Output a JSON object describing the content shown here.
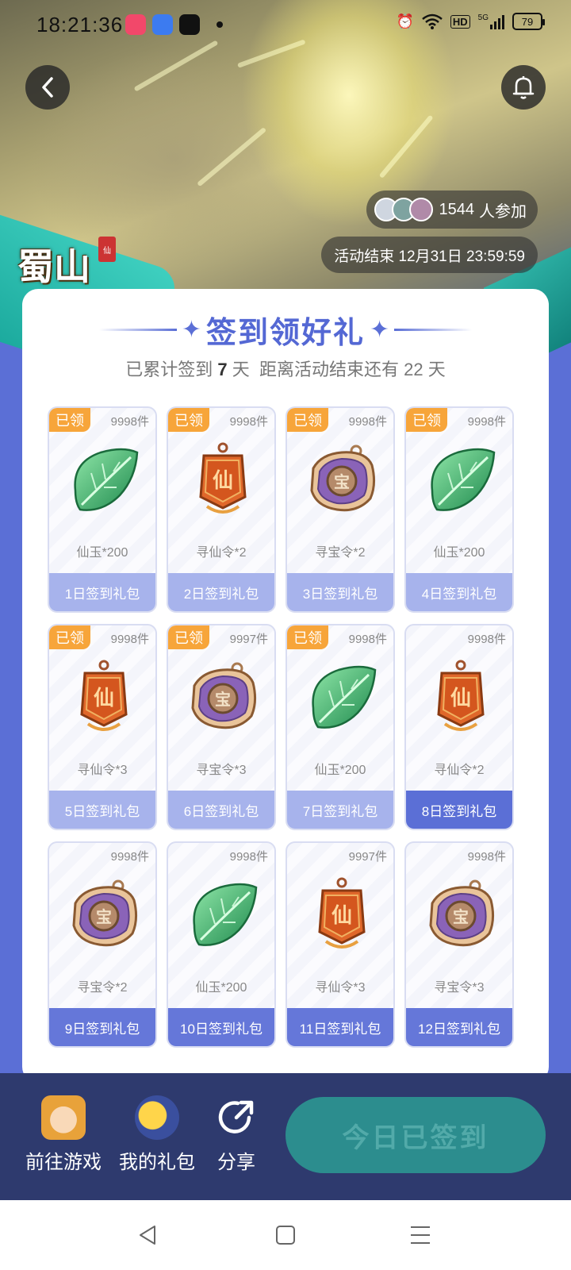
{
  "status_bar": {
    "time": "18:21:36",
    "network": "5G",
    "hd": "HD",
    "battery": "79"
  },
  "header": {
    "participants_count": "1544",
    "participants_suffix": "人参加",
    "end_time": "活动结束 12月31日 23:59:59",
    "game_logo_text": "蜀山"
  },
  "card": {
    "title": "签到领好礼",
    "subtitle_prefix": "已累计签到",
    "signed_days": "7",
    "subtitle_mid": "天  距离活动结束还有",
    "remaining_days": "22",
    "subtitle_suffix": "天"
  },
  "claimed_label": "已领",
  "rewards": [
    {
      "day_label": "1日签到礼包",
      "item": "仙玉*200",
      "stock": "9998件",
      "claimed": true,
      "icon": "jade-leaf-icon"
    },
    {
      "day_label": "2日签到礼包",
      "item": "寻仙令*2",
      "stock": "9998件",
      "claimed": true,
      "icon": "xian-token-icon"
    },
    {
      "day_label": "3日签到礼包",
      "item": "寻宝令*2",
      "stock": "9998件",
      "claimed": true,
      "icon": "treasure-token-icon"
    },
    {
      "day_label": "4日签到礼包",
      "item": "仙玉*200",
      "stock": "9998件",
      "claimed": true,
      "icon": "jade-leaf-icon"
    },
    {
      "day_label": "5日签到礼包",
      "item": "寻仙令*3",
      "stock": "9998件",
      "claimed": true,
      "icon": "xian-token-icon"
    },
    {
      "day_label": "6日签到礼包",
      "item": "寻宝令*3",
      "stock": "9997件",
      "claimed": true,
      "icon": "treasure-token-icon"
    },
    {
      "day_label": "7日签到礼包",
      "item": "仙玉*200",
      "stock": "9998件",
      "claimed": true,
      "icon": "jade-leaf-icon"
    },
    {
      "day_label": "8日签到礼包",
      "item": "寻仙令*2",
      "stock": "9998件",
      "claimed": false,
      "icon": "xian-token-icon"
    },
    {
      "day_label": "9日签到礼包",
      "item": "寻宝令*2",
      "stock": "9998件",
      "claimed": false,
      "icon": "treasure-token-icon"
    },
    {
      "day_label": "10日签到礼包",
      "item": "仙玉*200",
      "stock": "9998件",
      "claimed": false,
      "icon": "jade-leaf-icon"
    },
    {
      "day_label": "11日签到礼包",
      "item": "寻仙令*3",
      "stock": "9997件",
      "claimed": false,
      "icon": "xian-token-icon"
    },
    {
      "day_label": "12日签到礼包",
      "item": "寻宝令*3",
      "stock": "9998件",
      "claimed": false,
      "icon": "treasure-token-icon"
    }
  ],
  "bottom_bar": {
    "go_game": "前往游戏",
    "my_gifts": "我的礼包",
    "share": "分享",
    "checkin_button": "今日已签到"
  },
  "colors": {
    "accent": "#5b6fd6",
    "claimed_badge": "#f7a53a",
    "bottom_bar": "#2e3a6e",
    "checkin_button": "#2c8d8e"
  }
}
